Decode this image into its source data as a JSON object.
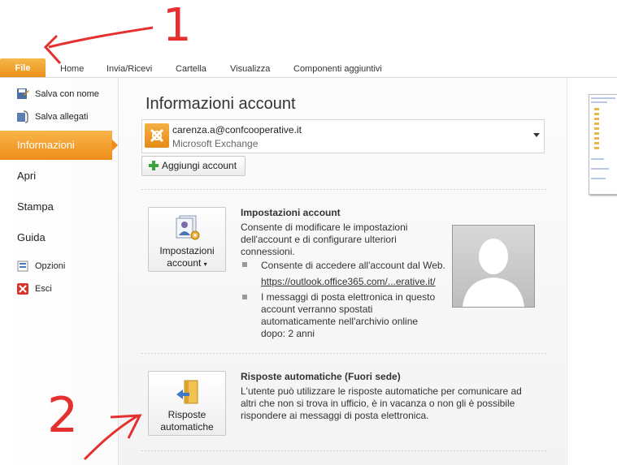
{
  "ribbon": {
    "tabs": [
      {
        "label": "File"
      },
      {
        "label": "Home"
      },
      {
        "label": "Invia/Ricevi"
      },
      {
        "label": "Cartella"
      },
      {
        "label": "Visualizza"
      },
      {
        "label": "Componenti aggiuntivi"
      }
    ]
  },
  "nav": {
    "save_as": "Salva con nome",
    "save_attachments": "Salva allegati",
    "info": "Informazioni",
    "open": "Apri",
    "print": "Stampa",
    "help": "Guida",
    "options": "Opzioni",
    "exit": "Esci"
  },
  "main": {
    "title": "Informazioni account",
    "account": {
      "email": "carenza.a@confcooperative.it",
      "type": "Microsoft Exchange"
    },
    "add_account": "Aggiungi account",
    "settings": {
      "button_line1": "Impostazioni",
      "button_line2": "account",
      "title": "Impostazioni account",
      "desc1": "Consente di modificare le impostazioni",
      "desc2": "dell'account e di configurare ulteriori",
      "desc3": "connessioni.",
      "bullet1": "Consente di accedere all'account dal Web.",
      "link": "https://outlook.office365.com/...erative.it/",
      "bullet2_l1": "I messaggi di posta elettronica in questo",
      "bullet2_l2": "account verranno spostati",
      "bullet2_l3": "automaticamente nell'archivio online",
      "bullet2_l4": "dopo: 2 anni"
    },
    "auto_reply": {
      "button_line1": "Risposte",
      "button_line2": "automatiche",
      "title": "Risposte automatiche (Fuori sede)",
      "desc1": "L'utente può utilizzare le risposte automatiche per comunicare ad",
      "desc2": "altri che non si trova in ufficio, è in vacanza o non gli è possibile",
      "desc3": "rispondere ai messaggi di posta elettronica."
    }
  },
  "annotations": {
    "one": "1",
    "two": "2"
  },
  "colors": {
    "accent": "#ee8d1a",
    "annotation": "#e53030"
  }
}
